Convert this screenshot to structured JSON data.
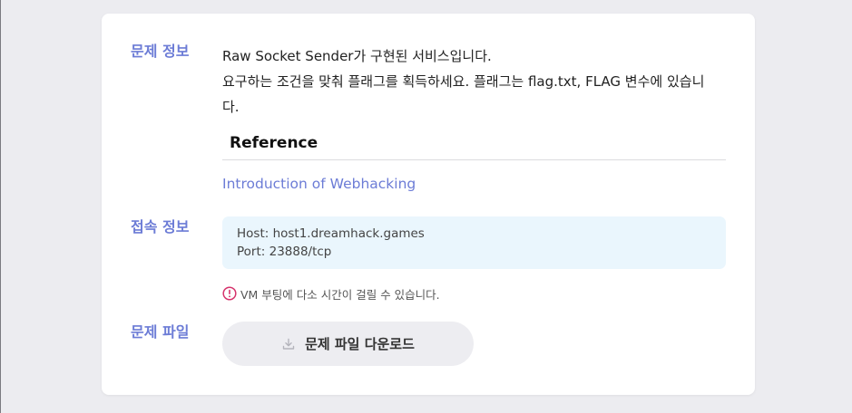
{
  "colors": {
    "accent": "#6c7cd6",
    "page_background": "#ececf0",
    "card_background": "#ffffff",
    "connection_box_background": "#eaf6fd",
    "warning": "#d6336c",
    "button_background": "#ededf1"
  },
  "problem_info": {
    "label": "문제 정보",
    "description_lines": [
      "Raw Socket Sender가 구현된 서비스입니다.",
      "요구하는 조건을 맞춰 플래그를 획득하세요. 플래그는 flag.txt, FLAG 변수에 있습니",
      "다."
    ],
    "reference_heading": "Reference",
    "reference_link": "Introduction of Webhacking"
  },
  "connection_info": {
    "label": "접속 정보",
    "host": "Host: host1.dreamhack.games",
    "port": "Port: 23888/tcp",
    "notice": "VM 부팅에 다소 시간이 걸릴 수 있습니다.",
    "notice_icon": "exclamation-circle-icon"
  },
  "problem_file": {
    "label": "문제 파일",
    "download_button_label": "문제 파일 다운로드",
    "download_icon": "download-icon"
  }
}
